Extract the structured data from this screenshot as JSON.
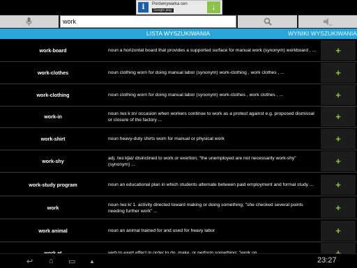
{
  "ad": {
    "title": "Porównywarka cen",
    "badge": "Google play",
    "icon_letter": "i"
  },
  "search": {
    "query": "work"
  },
  "tabs": {
    "list_label": "LISTA WYSZUKIWANIA",
    "results_label": "WYNIKI WYSZUKIWANIA"
  },
  "entries": [
    {
      "word": "work-board",
      "definition": "noun a horizontal board that provides a supported surface for manual work (synonym) workboard , ..."
    },
    {
      "word": "work-clothes",
      "definition": "noun clothing worn for doing manual labor (synonym) work-clothing , work clothes , ..."
    },
    {
      "word": "work-clothing",
      "definition": "noun clothing worn for doing manual labor (synonym) work-clothes , work clothes , ..."
    },
    {
      "word": "work-in",
      "definition": "noun /wɜːk ɪn/ occasion when workers continue to work as a protest against e.g. proposed dismissal or closure of the factory ..."
    },
    {
      "word": "work-shirt",
      "definition": "noun heavy-duty shirts worn for manual or physical work"
    },
    {
      "word": "work-shy",
      "definition": "adj. /wɜːkʃaɪ/ disinclined to work or exertion; \"the unemployed are not necessarily work-shy\" (synonym) ..."
    },
    {
      "word": "work-study program",
      "definition": "noun an educational plan in which students alternate between paid employment and formal study ..."
    },
    {
      "word": "work",
      "definition": "noun /wɜːk/ 1. activity directed toward making or doing something; \"she checked several points needing further work\" ..."
    },
    {
      "word": "work animal",
      "definition": "noun an animal trained for and used for heavy labor"
    },
    {
      "word": "work at",
      "definition": "verb to exert effect in order to do, make, or perform something; \"work on ..."
    }
  ],
  "add_label": "+",
  "system": {
    "clock": "23:27"
  },
  "colors": {
    "accent": "#29a6d9",
    "add": "#8cc63f"
  }
}
